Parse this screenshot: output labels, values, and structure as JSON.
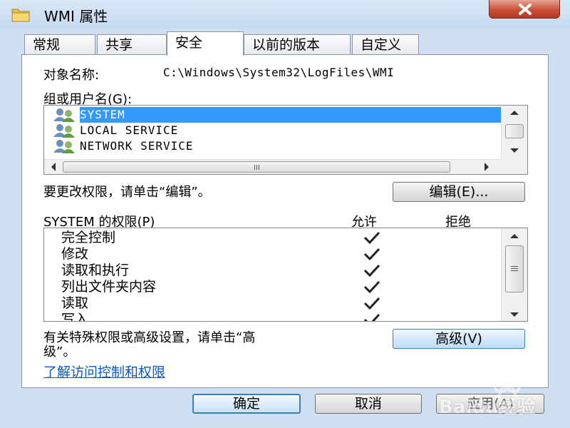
{
  "window": {
    "title": "WMI 属性",
    "close_icon": "close-icon"
  },
  "tabs": [
    {
      "label": "常规"
    },
    {
      "label": "共享"
    },
    {
      "label": "安全",
      "active": true
    },
    {
      "label": "以前的版本"
    },
    {
      "label": "自定义"
    }
  ],
  "object": {
    "label": "对象名称:",
    "value": "C:\\Windows\\System32\\LogFiles\\WMI"
  },
  "groups": {
    "label": "组或用户名(G):",
    "items": [
      {
        "name": "SYSTEM",
        "selected": true,
        "icon": "users-icon"
      },
      {
        "name": "LOCAL SERVICE",
        "selected": false,
        "icon": "users-icon"
      },
      {
        "name": "NETWORK SERVICE",
        "selected": false,
        "icon": "users-icon"
      }
    ]
  },
  "edit_hint": "要更改权限，请单击“编辑”。",
  "edit_button": "编辑(E)...",
  "permissions": {
    "label": "SYSTEM 的权限(P)",
    "allow_header": "允许",
    "deny_header": "拒绝",
    "rows": [
      {
        "name": "完全控制",
        "allow": true,
        "deny": false
      },
      {
        "name": "修改",
        "allow": true,
        "deny": false
      },
      {
        "name": "读取和执行",
        "allow": true,
        "deny": false
      },
      {
        "name": "列出文件夹内容",
        "allow": true,
        "deny": false
      },
      {
        "name": "读取",
        "allow": true,
        "deny": false
      },
      {
        "name": "写入",
        "allow": true,
        "deny": false
      }
    ]
  },
  "advanced_hint_line1": "有关特殊权限或高级设置，请单击“高",
  "advanced_hint_line2": "级”。",
  "advanced_button": "高级(V)",
  "help_link": "了解访问控制和权限",
  "footer": {
    "ok": "确定",
    "cancel": "取消",
    "apply": "应用(A)"
  },
  "watermark": {
    "text": "Baidu经验"
  }
}
